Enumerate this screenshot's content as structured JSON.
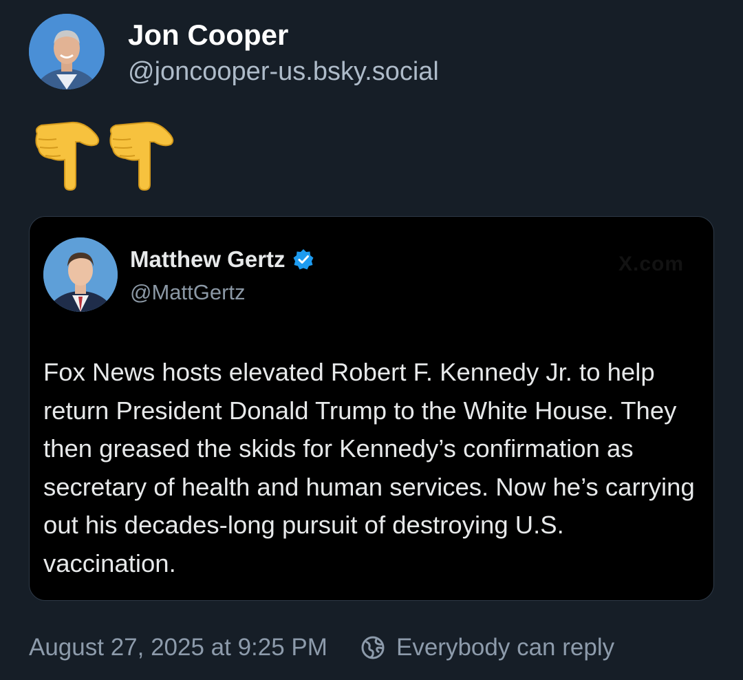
{
  "post": {
    "author": {
      "name": "Jon Cooper",
      "handle": "@joncooper-us.bsky.social",
      "avatar_icon": "avatar-photo"
    },
    "content_emojis": [
      "backhand-index-pointing-down-icon",
      "backhand-index-pointing-down-icon"
    ],
    "quoted": {
      "author": {
        "name": "Matthew Gertz",
        "handle": "@MattGertz",
        "verified": true,
        "verified_color": "#1d9bf0"
      },
      "watermark": "X.com",
      "text": "Fox News hosts elevated Robert F. Kennedy Jr. to help return President Donald Trump to the White House. They then greased the skids for Kennedy’s confirmation as secretary of health and human services. Now he’s carrying out his decades-long pursuit of destroying U.S. vaccination."
    },
    "timestamp": "August 27, 2025 at 9:25 PM",
    "reply_setting": {
      "icon": "globe-icon",
      "label": "Everybody can reply"
    }
  },
  "colors": {
    "background": "#161e27",
    "card_background": "#000000",
    "muted_text": "#8d9bab"
  }
}
